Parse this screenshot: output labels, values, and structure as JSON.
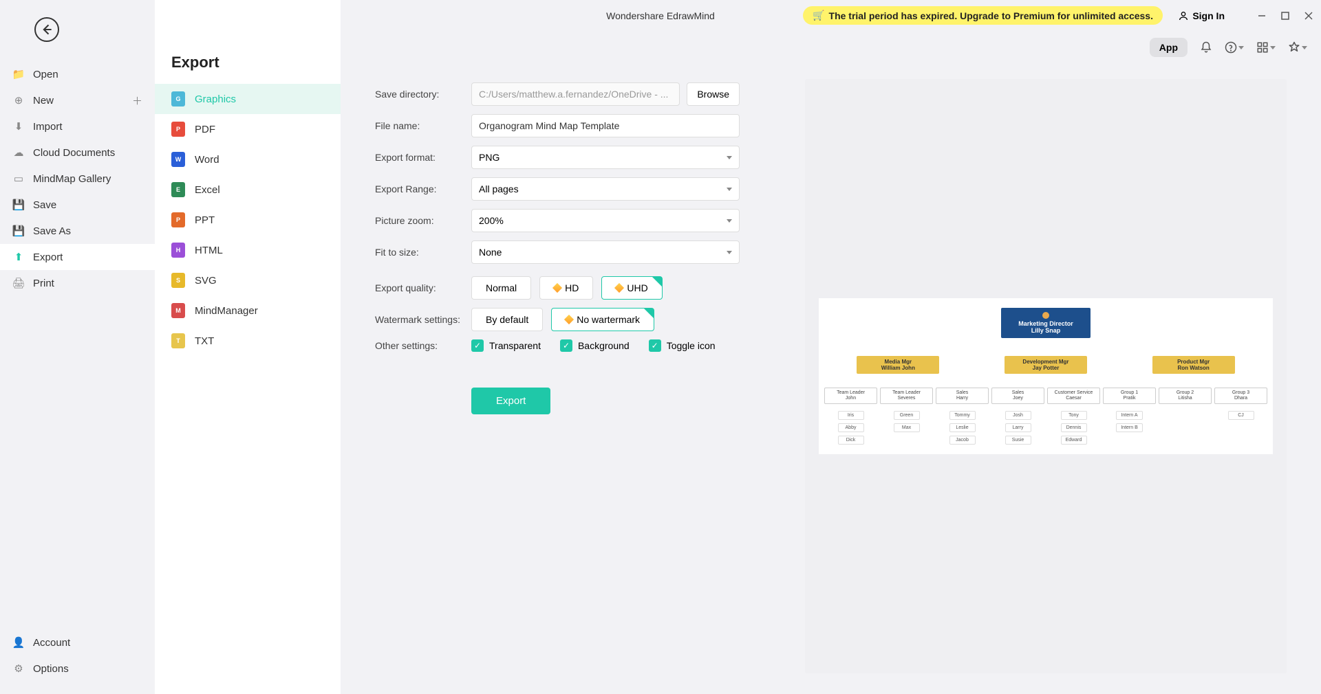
{
  "app_title": "Wondershare EdrawMind",
  "trial_banner": "The trial period has expired. Upgrade to Premium for unlimited access.",
  "signin": "Sign In",
  "toolbar": {
    "app_pill": "App"
  },
  "sidebar": {
    "items": [
      {
        "label": "Open"
      },
      {
        "label": "New"
      },
      {
        "label": "Import"
      },
      {
        "label": "Cloud Documents"
      },
      {
        "label": "MindMap Gallery"
      },
      {
        "label": "Save"
      },
      {
        "label": "Save As"
      },
      {
        "label": "Export"
      },
      {
        "label": "Print"
      }
    ],
    "bottom": [
      {
        "label": "Account"
      },
      {
        "label": "Options"
      }
    ]
  },
  "export_panel": {
    "title": "Export",
    "formats": [
      {
        "label": "Graphics",
        "color": "#4db8d8"
      },
      {
        "label": "PDF",
        "color": "#e74c3c"
      },
      {
        "label": "Word",
        "color": "#2a5fd8"
      },
      {
        "label": "Excel",
        "color": "#2e8b57"
      },
      {
        "label": "PPT",
        "color": "#e36a2a"
      },
      {
        "label": "HTML",
        "color": "#9b4fd8"
      },
      {
        "label": "SVG",
        "color": "#e7b92a"
      },
      {
        "label": "MindManager",
        "color": "#d84c4c"
      },
      {
        "label": "TXT",
        "color": "#e7c54c"
      }
    ]
  },
  "form": {
    "save_directory_label": "Save directory:",
    "save_directory_value": "C:/Users/matthew.a.fernandez/OneDrive - ...",
    "browse": "Browse",
    "file_name_label": "File name:",
    "file_name_value": "Organogram Mind Map Template",
    "export_format_label": "Export format:",
    "export_format_value": "PNG",
    "export_range_label": "Export Range:",
    "export_range_value": "All pages",
    "picture_zoom_label": "Picture zoom:",
    "picture_zoom_value": "200%",
    "fit_to_size_label": "Fit to size:",
    "fit_to_size_value": "None",
    "export_quality_label": "Export quality:",
    "quality": {
      "normal": "Normal",
      "hd": "HD",
      "uhd": "UHD"
    },
    "watermark_label": "Watermark settings:",
    "watermark": {
      "default": "By default",
      "none": "No wartermark"
    },
    "other_label": "Other settings:",
    "cb": {
      "transparent": "Transparent",
      "background": "Background",
      "toggle": "Toggle icon"
    },
    "export_btn": "Export"
  },
  "preview_chart": {
    "root": {
      "title": "Marketing Director",
      "name": "Lilly Snap"
    },
    "managers": [
      {
        "title": "Media Mgr",
        "name": "William John"
      },
      {
        "title": "Development Mgr",
        "name": "Jay Potter"
      },
      {
        "title": "Product Mgr",
        "name": "Ron Watson"
      }
    ],
    "leads": [
      {
        "title": "Team Leader",
        "name": "John"
      },
      {
        "title": "Team Leader",
        "name": "Severes"
      },
      {
        "title": "Sales",
        "name": "Harry"
      },
      {
        "title": "Sales",
        "name": "Joey"
      },
      {
        "title": "Customer Service",
        "name": "Caesar"
      },
      {
        "title": "Group 1",
        "name": "Pratik"
      },
      {
        "title": "Group 2",
        "name": "Litisha"
      },
      {
        "title": "Group 3",
        "name": "Dhara"
      }
    ],
    "members": [
      [
        "Iris",
        "Abby",
        "Dick"
      ],
      [
        "Green",
        "Max"
      ],
      [
        "Tommy",
        "Leslie",
        "Jacob"
      ],
      [
        "Josh",
        "Larry",
        "Susie"
      ],
      [
        "Tony",
        "Dennis",
        "Edward"
      ],
      [
        "Intern A",
        "Intern B"
      ],
      [],
      [
        "CJ"
      ]
    ]
  }
}
